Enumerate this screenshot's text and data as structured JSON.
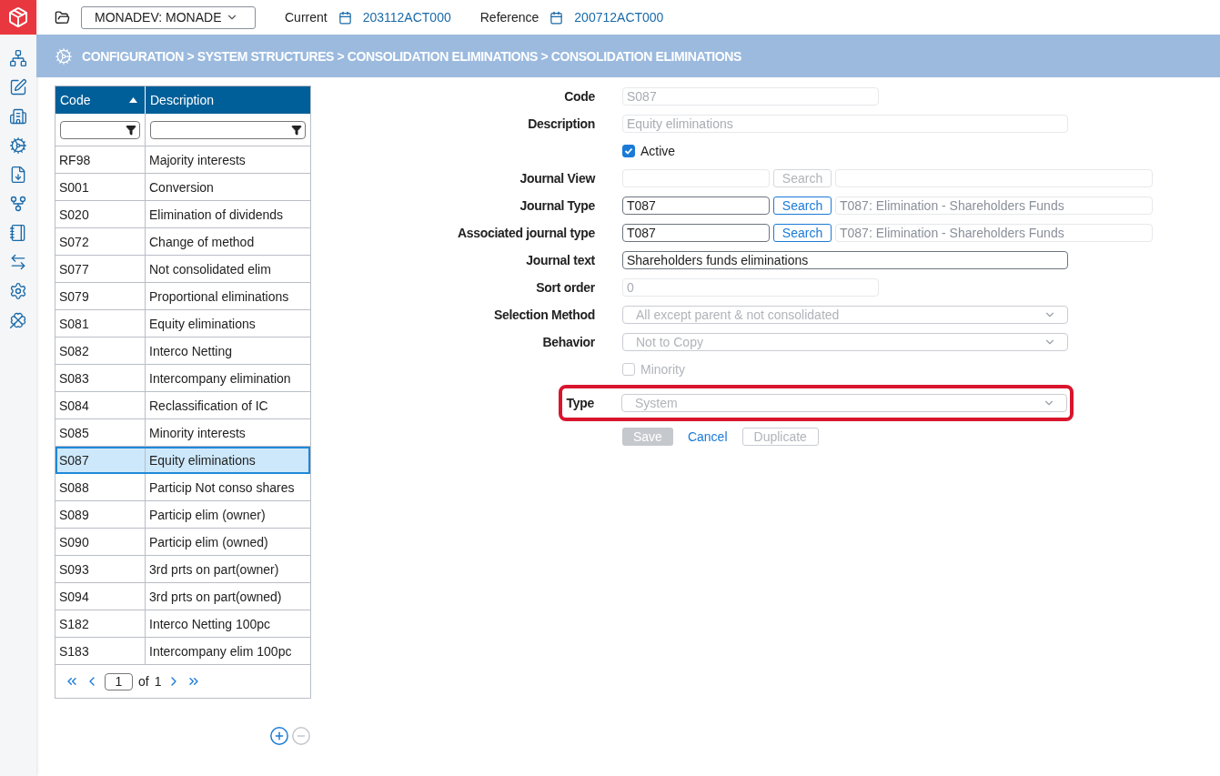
{
  "topbar": {
    "environment": "MONADEV: MONADE",
    "current_label": "Current",
    "current_value": "203112ACT000",
    "reference_label": "Reference",
    "reference_value": "200712ACT000"
  },
  "breadcrumb": "CONFIGURATION > SYSTEM STRUCTURES > CONSOLIDATION ELIMINATIONS > CONSOLIDATION ELIMINATIONS",
  "table": {
    "columns": [
      {
        "label": "Code",
        "sorted": true
      },
      {
        "label": "Description",
        "sorted": false
      }
    ],
    "rows": [
      {
        "code": "RF98",
        "description": "Majority interests",
        "selected": false
      },
      {
        "code": "S001",
        "description": "Conversion",
        "selected": false
      },
      {
        "code": "S020",
        "description": "Elimination of dividends",
        "selected": false
      },
      {
        "code": "S072",
        "description": "Change of method",
        "selected": false
      },
      {
        "code": "S077",
        "description": "Not consolidated elim",
        "selected": false
      },
      {
        "code": "S079",
        "description": "Proportional eliminations",
        "selected": false
      },
      {
        "code": "S081",
        "description": "Equity eliminations",
        "selected": false
      },
      {
        "code": "S082",
        "description": "Interco Netting",
        "selected": false
      },
      {
        "code": "S083",
        "description": "Intercompany elimination",
        "selected": false
      },
      {
        "code": "S084",
        "description": "Reclassification of IC",
        "selected": false
      },
      {
        "code": "S085",
        "description": "Minority interests",
        "selected": false
      },
      {
        "code": "S087",
        "description": "Equity eliminations",
        "selected": true
      },
      {
        "code": "S088",
        "description": "Particip Not conso shares",
        "selected": false
      },
      {
        "code": "S089",
        "description": "Particip elim (owner)",
        "selected": false
      },
      {
        "code": "S090",
        "description": "Particip elim (owned)",
        "selected": false
      },
      {
        "code": "S093",
        "description": "3rd prts on part(owner)",
        "selected": false
      },
      {
        "code": "S094",
        "description": "3rd prts on part(owned)",
        "selected": false
      },
      {
        "code": "S182",
        "description": "Interco Netting 100pc",
        "selected": false
      },
      {
        "code": "S183",
        "description": "Intercompany elim 100pc",
        "selected": false
      }
    ],
    "pagination": {
      "page": "1",
      "of_label": "of",
      "total": "1"
    },
    "add_enabled": true,
    "remove_enabled": false
  },
  "form": {
    "fields": [
      {
        "kind": "short_text",
        "label": "Code",
        "value": "S087",
        "disabled": true
      },
      {
        "kind": "text",
        "label": "Description",
        "value": "Equity eliminations",
        "disabled": true
      },
      {
        "kind": "checkbox",
        "label": "Active",
        "checked": true,
        "disabled": false
      },
      {
        "kind": "lookup",
        "label": "Journal View",
        "button": "Search",
        "disabled": true
      },
      {
        "kind": "lookup",
        "label": "Journal Type",
        "value": "T087",
        "button": "Search",
        "description": "T087: Elimination - Shareholders Funds",
        "disabled": false
      },
      {
        "kind": "lookup",
        "label": "Associated journal type",
        "value": "T087",
        "button": "Search",
        "description": "T087: Elimination - Shareholders Funds",
        "disabled": false
      },
      {
        "kind": "text",
        "label": "Journal text",
        "value": "Shareholders funds eliminations",
        "disabled": false
      },
      {
        "kind": "short_text",
        "label": "Sort order",
        "value": "0",
        "disabled": true
      },
      {
        "kind": "select",
        "label": "Selection Method",
        "value": "All except parent & not consolidated",
        "disabled": true
      },
      {
        "kind": "select",
        "label": "Behavior",
        "value": "Not to Copy",
        "disabled": true
      },
      {
        "kind": "checkbox",
        "label": "Minority",
        "checked": false,
        "disabled": true
      },
      {
        "kind": "select",
        "label": "Type",
        "value": "System",
        "disabled": true,
        "highlighted": true
      }
    ],
    "buttons": [
      {
        "kind": "primary",
        "label": "Save",
        "disabled": true
      },
      {
        "kind": "link",
        "label": "Cancel"
      },
      {
        "kind": "secondary",
        "label": "Duplicate",
        "disabled": true
      }
    ]
  }
}
